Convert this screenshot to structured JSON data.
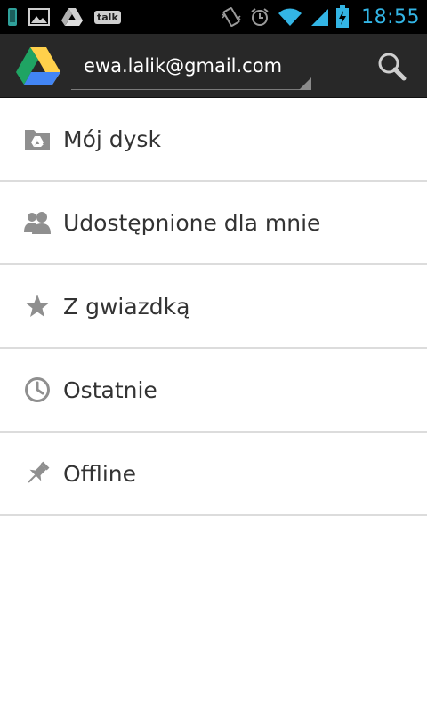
{
  "status_bar": {
    "time": "18:55",
    "talk_badge": "talk",
    "clock_color": "#33b5e5",
    "icons": [
      "phone-icon",
      "image-icon",
      "drive-notification-icon",
      "talk-icon",
      "vibrate-icon",
      "alarm-icon",
      "wifi-icon",
      "signal-icon",
      "battery-charging-icon"
    ]
  },
  "action_bar": {
    "account": "ewa.lalik@gmail.com",
    "logo": "google-drive-logo",
    "search_icon": "search-icon"
  },
  "nav": {
    "items": [
      {
        "label": "Mój dysk",
        "icon": "drive-folder-icon"
      },
      {
        "label": "Udostępnione dla mnie",
        "icon": "people-icon"
      },
      {
        "label": "Z gwiazdką",
        "icon": "star-icon"
      },
      {
        "label": "Ostatnie",
        "icon": "clock-icon"
      },
      {
        "label": "Offline",
        "icon": "pin-icon"
      }
    ]
  },
  "colors": {
    "status_bg": "#000000",
    "action_bar_bg": "#282828",
    "icon_gray": "#8f8f8f",
    "text": "#333333",
    "divider": "#dcdcdc"
  }
}
